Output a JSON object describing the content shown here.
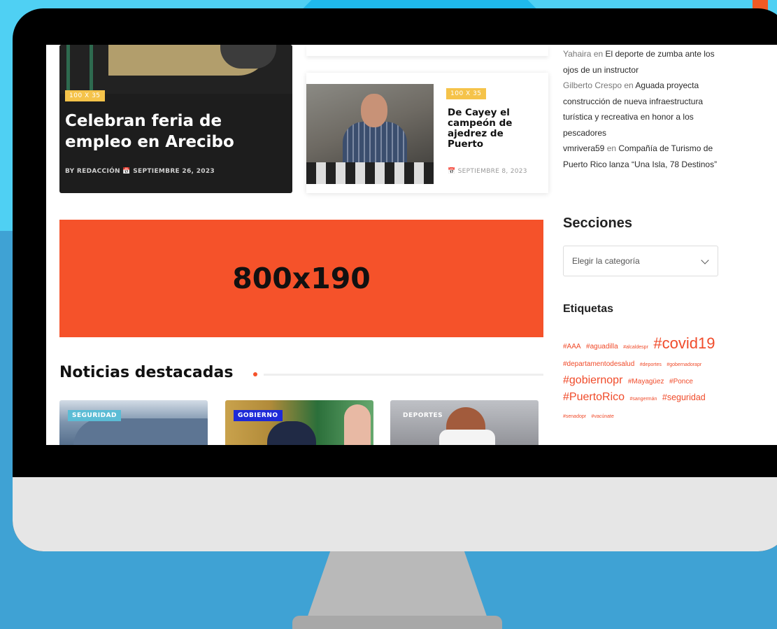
{
  "colors": {
    "accent": "#f5522a",
    "badge_yellow": "#f5c34a",
    "tag_red": "#f04b2a",
    "bezel": "#000000",
    "background": "#3fa2d4"
  },
  "card_main": {
    "badge": "100 X 35",
    "title": "Celebran feria de empleo en Arecibo",
    "meta": "BY REDACCIÓN   📅 SEPTIEMBRE 26, 2023"
  },
  "card_side": {
    "badge": "100 X 35",
    "title": "De Cayey el campeón de ajedrez de Puerto",
    "date": "📅 SEPTIEMBRE 8, 2023"
  },
  "ad": {
    "text": "800x190"
  },
  "featured": {
    "heading": "Noticias destacadas",
    "items": [
      {
        "tag": "SEGURIDAD"
      },
      {
        "tag": "GOBIERNO"
      },
      {
        "tag": "DEPORTES"
      }
    ]
  },
  "sidebar": {
    "comments": [
      {
        "author": "Yahaira",
        "sep": " en ",
        "post": "El deporte de zumba ante los ojos de un instructor"
      },
      {
        "author": "Gilberto Crespo",
        "sep": " en ",
        "post": "Aguada proyecta construcción de nueva infraestructura turística y recreativa en honor a los pescadores"
      },
      {
        "author": "vmrivera59",
        "sep": " en ",
        "post": "Compañía de Turismo de Puerto Rico lanza “Una Isla, 78 Destinos”"
      }
    ],
    "sections_title": "Secciones",
    "category_select": "Elegir la categoría",
    "tags_title": "Etiquetas",
    "tags": [
      {
        "t": "#AAA",
        "s": "fs-s"
      },
      {
        "t": "#aguadilla",
        "s": "fs-s"
      },
      {
        "t": "#alcaldespr",
        "s": "fs-xs"
      },
      {
        "t": "#covid19",
        "s": "fs-xl"
      },
      {
        "t": "#departamentodesalud",
        "s": "fs-s"
      },
      {
        "t": "#deportes",
        "s": "fs-xs"
      },
      {
        "t": "#gobernadorapr",
        "s": "fs-xs"
      },
      {
        "t": "#gobiernopr",
        "s": "fs-l"
      },
      {
        "t": "#Mayagüez",
        "s": "fs-s"
      },
      {
        "t": "#Ponce",
        "s": "fs-s"
      },
      {
        "t": "#PuertoRico",
        "s": "fs-l"
      },
      {
        "t": "#sangermán",
        "s": "fs-xs"
      },
      {
        "t": "#seguridad",
        "s": "fs-m"
      },
      {
        "t": "#senadopr",
        "s": "fs-xs"
      },
      {
        "t": "#vacúnate",
        "s": "fs-xs"
      }
    ]
  }
}
